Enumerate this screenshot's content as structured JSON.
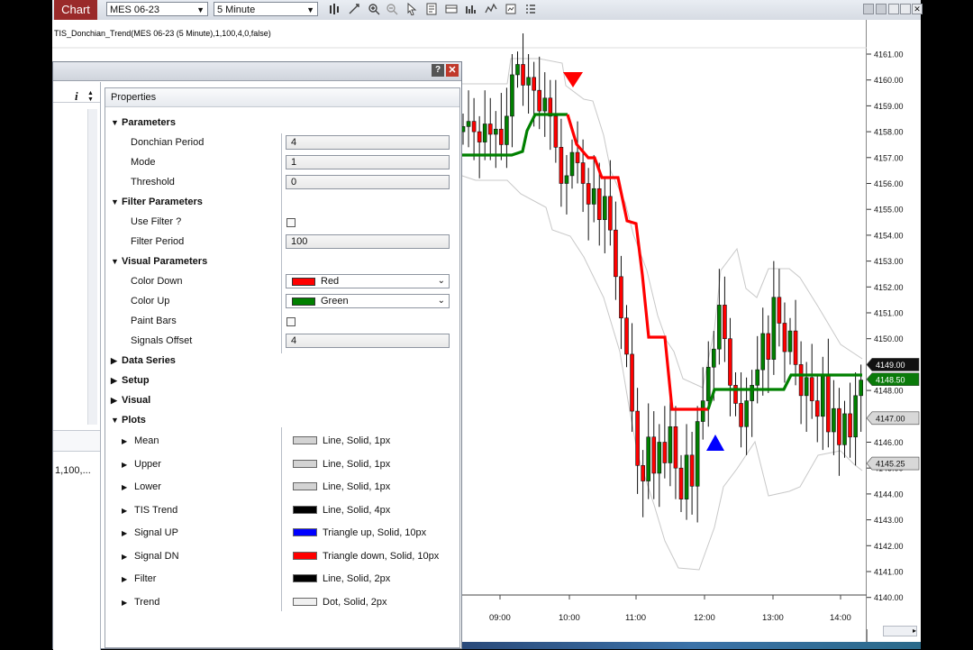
{
  "toolbar": {
    "tab": "Chart",
    "instrument": "MES 06-23",
    "interval": "5 Minute"
  },
  "indicator_label": "TIS_Donchian_Trend(MES 06-23 (5 Minute),1,100,4,0,false)",
  "dialog": {
    "help": "?",
    "close": "✕",
    "left_row": "1,100,...",
    "properties_header": "Properties",
    "categories": {
      "parameters": "Parameters",
      "filter_parameters": "Filter Parameters",
      "visual_parameters": "Visual Parameters",
      "data_series": "Data Series",
      "setup": "Setup",
      "visual": "Visual",
      "plots": "Plots"
    },
    "params": {
      "donchian_period": {
        "label": "Donchian Period",
        "value": "4"
      },
      "mode": {
        "label": "Mode",
        "value": "1"
      },
      "threshold": {
        "label": "Threshold",
        "value": "0"
      },
      "use_filter": {
        "label": "Use Filter ?"
      },
      "filter_period": {
        "label": "Filter Period",
        "value": "100"
      },
      "color_down": {
        "label": "Color Down",
        "value": "Red",
        "swatch": "#ff0000"
      },
      "color_up": {
        "label": "Color Up",
        "value": "Green",
        "swatch": "#008000"
      },
      "paint_bars": {
        "label": "Paint Bars"
      },
      "signals_offset": {
        "label": "Signals Offset",
        "value": "4"
      }
    },
    "plots": [
      {
        "name": "Mean",
        "value": "Line, Solid, 1px",
        "swatch": "#d3d3d3"
      },
      {
        "name": "Upper",
        "value": "Line, Solid, 1px",
        "swatch": "#d3d3d3"
      },
      {
        "name": "Lower",
        "value": "Line, Solid, 1px",
        "swatch": "#d3d3d3"
      },
      {
        "name": "TIS Trend",
        "value": "Line, Solid, 4px",
        "swatch": "#000000"
      },
      {
        "name": "Signal UP",
        "value": "Triangle up, Solid, 10px",
        "swatch": "#0000ff"
      },
      {
        "name": "Signal DN",
        "value": "Triangle down, Solid, 10px",
        "swatch": "#ff0000"
      },
      {
        "name": "Filter",
        "value": "Line, Solid, 2px",
        "swatch": "#000000"
      },
      {
        "name": "Trend",
        "value": "Dot, Solid, 2px",
        "swatch": "#f0f0f0"
      }
    ]
  },
  "price_axis": {
    "ticks": [
      "4161.00",
      "4160.00",
      "4159.00",
      "4158.00",
      "4157.00",
      "4156.00",
      "4155.00",
      "4154.00",
      "4153.00",
      "4152.00",
      "4151.00",
      "4150.00",
      "4149.00",
      "4148.50",
      "4148.00",
      "4147.00",
      "4146.00",
      "4145.25",
      "4145.00",
      "4144.00",
      "4143.00",
      "4142.00",
      "4141.00",
      "4140.00"
    ],
    "current_price": "4149.00",
    "trend_price": "4148.50",
    "label_1": "4147.00",
    "label_2": "4145.25"
  },
  "time_axis": {
    "labels": [
      "09:00",
      "10:00",
      "11:00",
      "12:00",
      "13:00",
      "14:00"
    ]
  },
  "colors": {
    "down": "#ff0000",
    "up": "#008000",
    "signal_up": "#0000ff",
    "signal_dn": "#ff0000",
    "chart_tab": "#9a2a2a"
  }
}
